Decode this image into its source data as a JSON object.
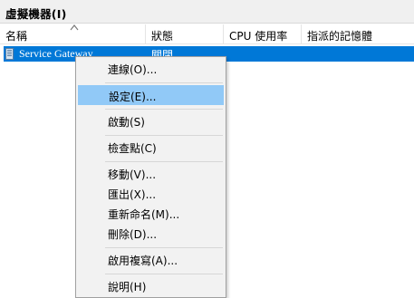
{
  "section": {
    "title": "虛擬機器(I)"
  },
  "columns": [
    {
      "label": "名稱"
    },
    {
      "label": "狀態"
    },
    {
      "label": "CPU 使用率"
    },
    {
      "label": "指派的記憶體"
    }
  ],
  "vm": {
    "name": "Service Gateway",
    "state": "關閉"
  },
  "menu": {
    "items": [
      {
        "label": "連線(O)..."
      },
      {
        "label": "設定(E)...",
        "selected": true
      },
      {
        "label": "啟動(S)"
      },
      {
        "label": "檢查點(C)"
      },
      {
        "label": "移動(V)..."
      },
      {
        "label": "匯出(X)..."
      },
      {
        "label": "重新命名(M)..."
      },
      {
        "label": "刪除(D)..."
      },
      {
        "label": "啟用複寫(A)..."
      },
      {
        "label": "說明(H)"
      }
    ]
  },
  "colors": {
    "selection": "#0078d7",
    "menu_highlight": "#91c9f7",
    "menu_background": "#f2f2f2",
    "title_background": "#f0f0f0"
  },
  "icons": {
    "vm": "vm-icon",
    "sort": "sort-ascending-icon"
  }
}
